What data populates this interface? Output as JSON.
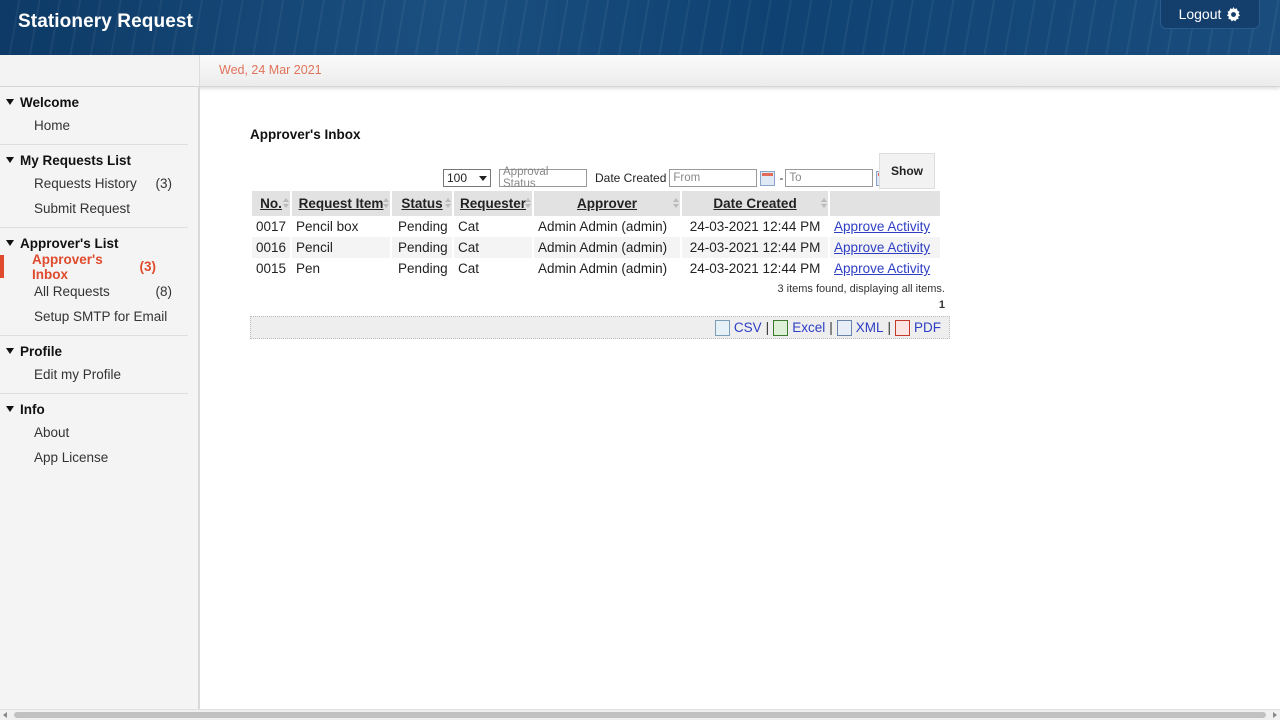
{
  "app": {
    "title": "Stationery Request",
    "logout_label": "Logout"
  },
  "datebar": {
    "date": "Wed, 24 Mar 2021"
  },
  "sidebar": {
    "groups": [
      {
        "title": "Welcome",
        "items": [
          {
            "label": "Home",
            "count": ""
          }
        ]
      },
      {
        "title": "My Requests List",
        "items": [
          {
            "label": "Requests History",
            "count": "(3)"
          },
          {
            "label": "Submit Request",
            "count": ""
          }
        ]
      },
      {
        "title": "Approver's List",
        "items": [
          {
            "label": "Approver's Inbox",
            "count": "(3)",
            "active": true
          },
          {
            "label": "All Requests",
            "count": "(8)"
          },
          {
            "label": "Setup SMTP for Email",
            "count": ""
          }
        ]
      },
      {
        "title": "Profile",
        "items": [
          {
            "label": "Edit my Profile",
            "count": ""
          }
        ]
      },
      {
        "title": "Info",
        "items": [
          {
            "label": "About",
            "count": ""
          },
          {
            "label": "App License",
            "count": ""
          }
        ]
      }
    ]
  },
  "main": {
    "title": "Approver's Inbox",
    "filters": {
      "page_size": "100",
      "status_placeholder": "Approval Status",
      "date_label": "Date Created",
      "from_placeholder": "From",
      "dash": "-",
      "to_placeholder": "To",
      "show_label": "Show"
    },
    "table": {
      "columns": [
        "No.",
        "Request Item",
        "Status",
        "Requester",
        "Approver",
        "Date Created",
        ""
      ],
      "rows": [
        [
          "0017",
          "Pencil box",
          "Pending",
          "Cat",
          "Admin Admin (admin)",
          "24-03-2021 12:44 PM",
          "Approve Activity"
        ],
        [
          "0016",
          "Pencil",
          "Pending",
          "Cat",
          "Admin Admin (admin)",
          "24-03-2021 12:44 PM",
          "Approve Activity"
        ],
        [
          "0015",
          "Pen",
          "Pending",
          "Cat",
          "Admin Admin (admin)",
          "24-03-2021 12:44 PM",
          "Approve Activity"
        ]
      ]
    },
    "summary": "3 items found, displaying all items.",
    "page": "1",
    "export": {
      "csv": "CSV",
      "excel": "Excel",
      "xml": "XML",
      "pdf": "PDF",
      "separator": "|"
    }
  }
}
